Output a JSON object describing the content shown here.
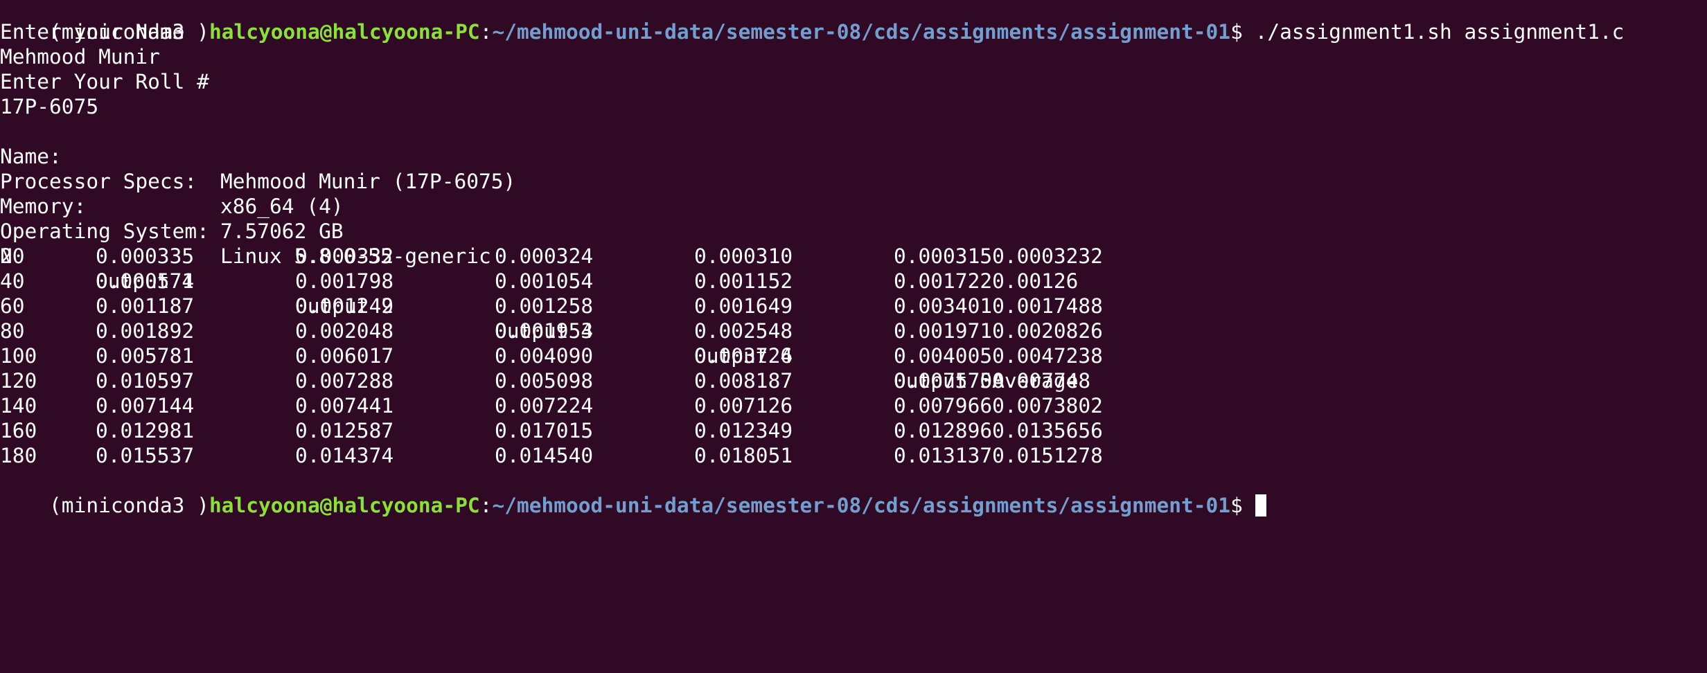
{
  "prompt": {
    "env": "(miniconda3 )",
    "user_host": "halcyoona@halcyoona-PC",
    "colon": ":",
    "path": "~/mehmood-uni-data/semester-08/cds/assignments/assignment-01",
    "dollar": "$ ",
    "command": "./assignment1.sh assignment1.c"
  },
  "output_lines": [
    "Enter your Name",
    "Mehmood Munir",
    "Enter Your Roll #",
    "17P-6075"
  ],
  "info": [
    {
      "label": "Name:",
      "value": "Mehmood Munir (17P-6075)"
    },
    {
      "label": "Processor Specs:",
      "value": "x86_64 (4)"
    },
    {
      "label": "Memory:",
      "value": "7.57062 GB"
    },
    {
      "label": "Operating System:",
      "value": "Linux 5.8.0-55-generic"
    }
  ],
  "table": {
    "headers": [
      "N",
      "Output 1",
      "Output 2",
      "Output 3",
      "Output 4",
      "Output 5Average"
    ],
    "rows": [
      [
        "20",
        "0.000335",
        "0.000332",
        "0.000324",
        "0.000310",
        "0.0003150.0003232"
      ],
      [
        "40",
        "0.000574",
        "0.001798",
        "0.001054",
        "0.001152",
        "0.0017220.00126"
      ],
      [
        "60",
        "0.001187",
        "0.001249",
        "0.001258",
        "0.001649",
        "0.0034010.0017488"
      ],
      [
        "80",
        "0.001892",
        "0.002048",
        "0.001954",
        "0.002548",
        "0.0019710.0020826"
      ],
      [
        "100",
        "0.005781",
        "0.006017",
        "0.004090",
        "0.003726",
        "0.0040050.0047238"
      ],
      [
        "120",
        "0.010597",
        "0.007288",
        "0.005098",
        "0.008187",
        "0.0075700.007748"
      ],
      [
        "140",
        "0.007144",
        "0.007441",
        "0.007224",
        "0.007126",
        "0.0079660.0073802"
      ],
      [
        "160",
        "0.012981",
        "0.012587",
        "0.017015",
        "0.012349",
        "0.0128960.0135656"
      ],
      [
        "180",
        "0.015537",
        "0.014374",
        "0.014540",
        "0.018051",
        "0.0131370.0151278"
      ]
    ]
  },
  "final_prompt": {
    "env": "(miniconda3 )",
    "user_host": "halcyoona@halcyoona-PC",
    "colon": ":",
    "path": "~/mehmood-uni-data/semester-08/cds/assignments/assignment-01",
    "dollar": "$ "
  },
  "colors": {
    "background": "#300a24",
    "user_host": "#8ae234",
    "path": "#729fcf",
    "text": "#ffffff"
  }
}
